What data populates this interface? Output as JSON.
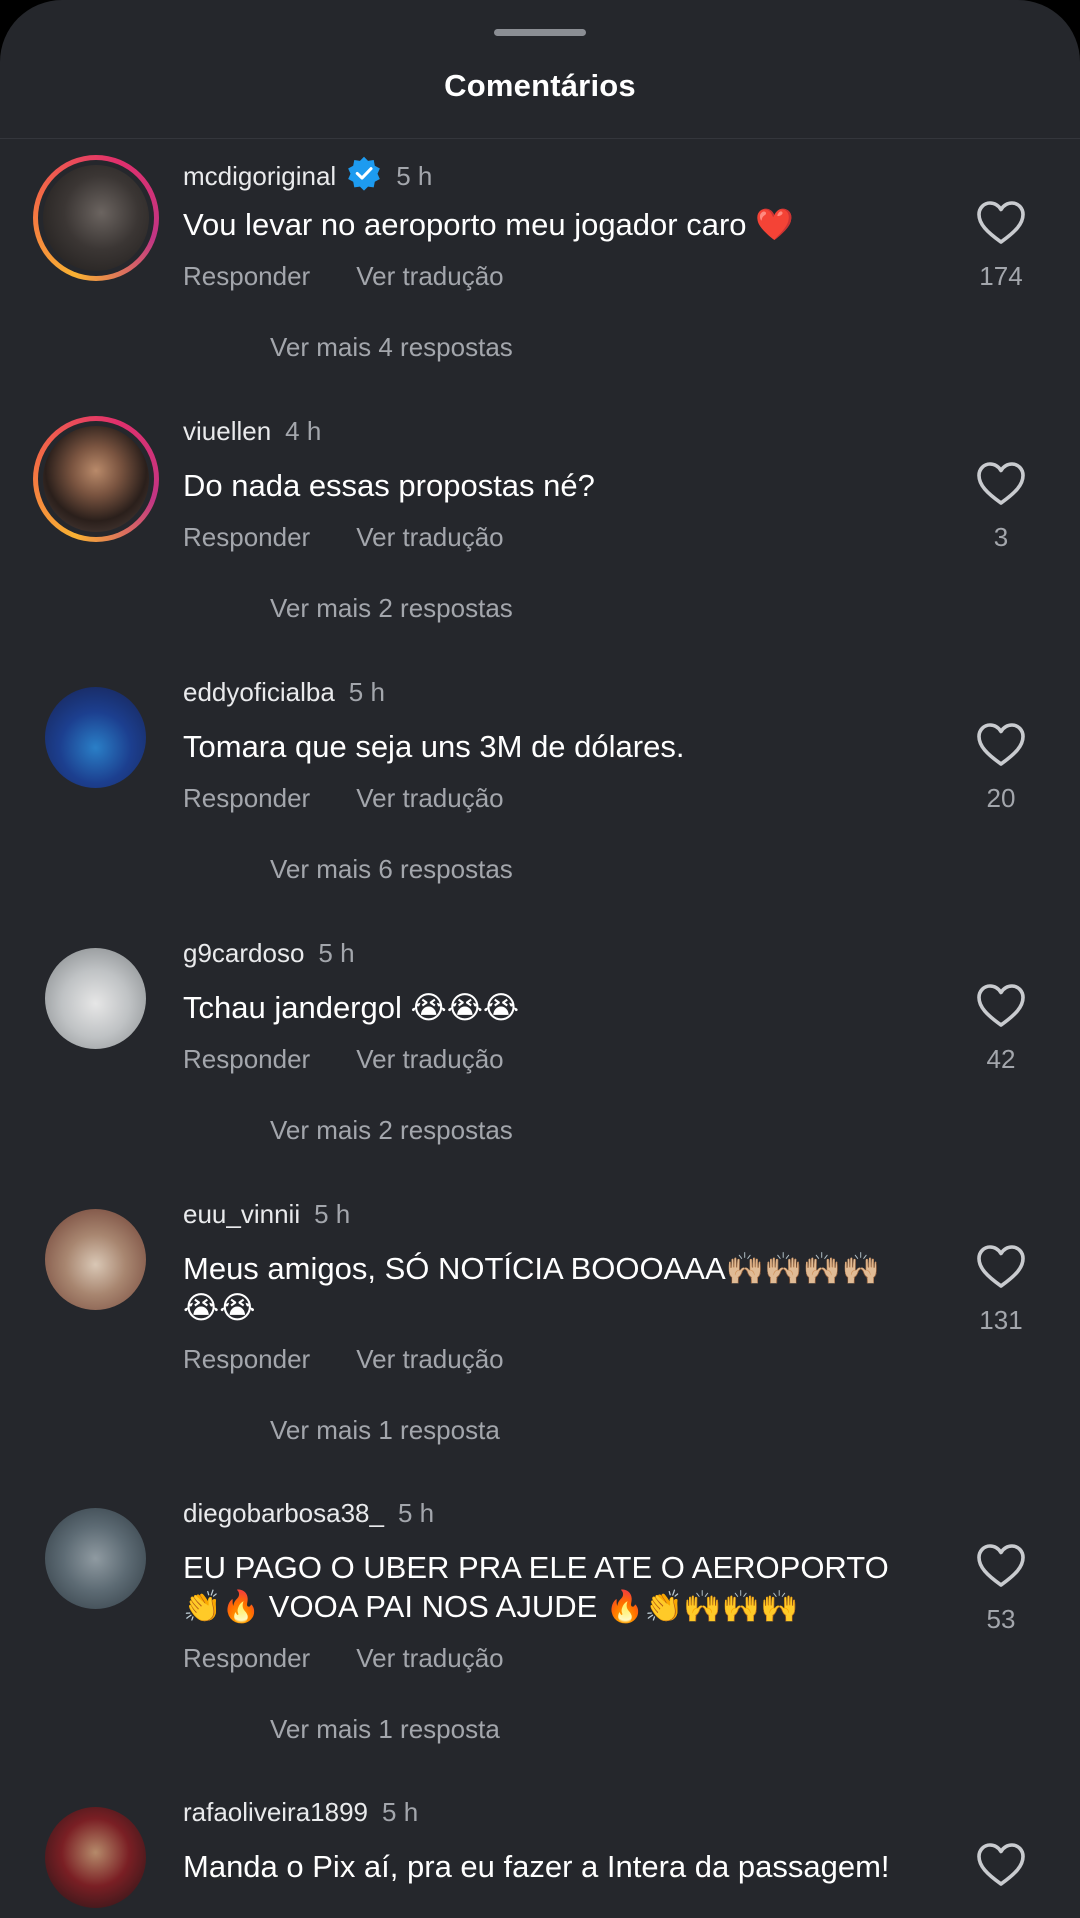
{
  "header": {
    "title": "Comentários"
  },
  "labels": {
    "reply": "Responder",
    "translate": "Ver tradução"
  },
  "comments": [
    {
      "username": "mcdigoriginal",
      "verified": true,
      "time": "5 h",
      "text": "Vou levar no aeroporto meu jogador caro ❤️",
      "likes": "174",
      "more": "Ver mais 4 respostas"
    },
    {
      "username": "viuellen",
      "verified": false,
      "time": "4 h",
      "text": "Do nada essas propostas né?",
      "likes": "3",
      "more": "Ver mais 2 respostas"
    },
    {
      "username": "eddyoficialba",
      "verified": false,
      "time": "5 h",
      "text": "Tomara que seja uns 3M de dólares.",
      "likes": "20",
      "more": "Ver mais 6 respostas"
    },
    {
      "username": "g9cardoso",
      "verified": false,
      "time": "5 h",
      "text": "Tchau jandergol 😭😭😭",
      "likes": "42",
      "more": "Ver mais 2 respostas"
    },
    {
      "username": "euu_vinnii",
      "verified": false,
      "time": "5 h",
      "text": "Meus amigos, SÓ NOTÍCIA BOOOAAA🙌🏼🙌🏼🙌🏼🙌🏼😭😭",
      "likes": "131",
      "more": "Ver mais 1 resposta"
    },
    {
      "username": "diegobarbosa38_",
      "verified": false,
      "time": "5 h",
      "text": "EU PAGO O UBER PRA ELE ATE O AEROPORTO 👏🔥 VOOA PAI NOS AJUDE 🔥👏🙌🙌🙌",
      "likes": "53",
      "more": "Ver mais 1 resposta"
    },
    {
      "username": "rafaoliveira1899",
      "verified": false,
      "time": "5 h",
      "text": "Manda o Pix aí, pra eu fazer a Intera da passagem!",
      "likes": "",
      "more": ""
    }
  ],
  "icons": {
    "like": "heart-outline-icon",
    "verified": "verified-badge-icon"
  },
  "colors": {
    "background": "#25272c",
    "verified": "#1d9bf0",
    "muted": "#a3a6ac"
  }
}
